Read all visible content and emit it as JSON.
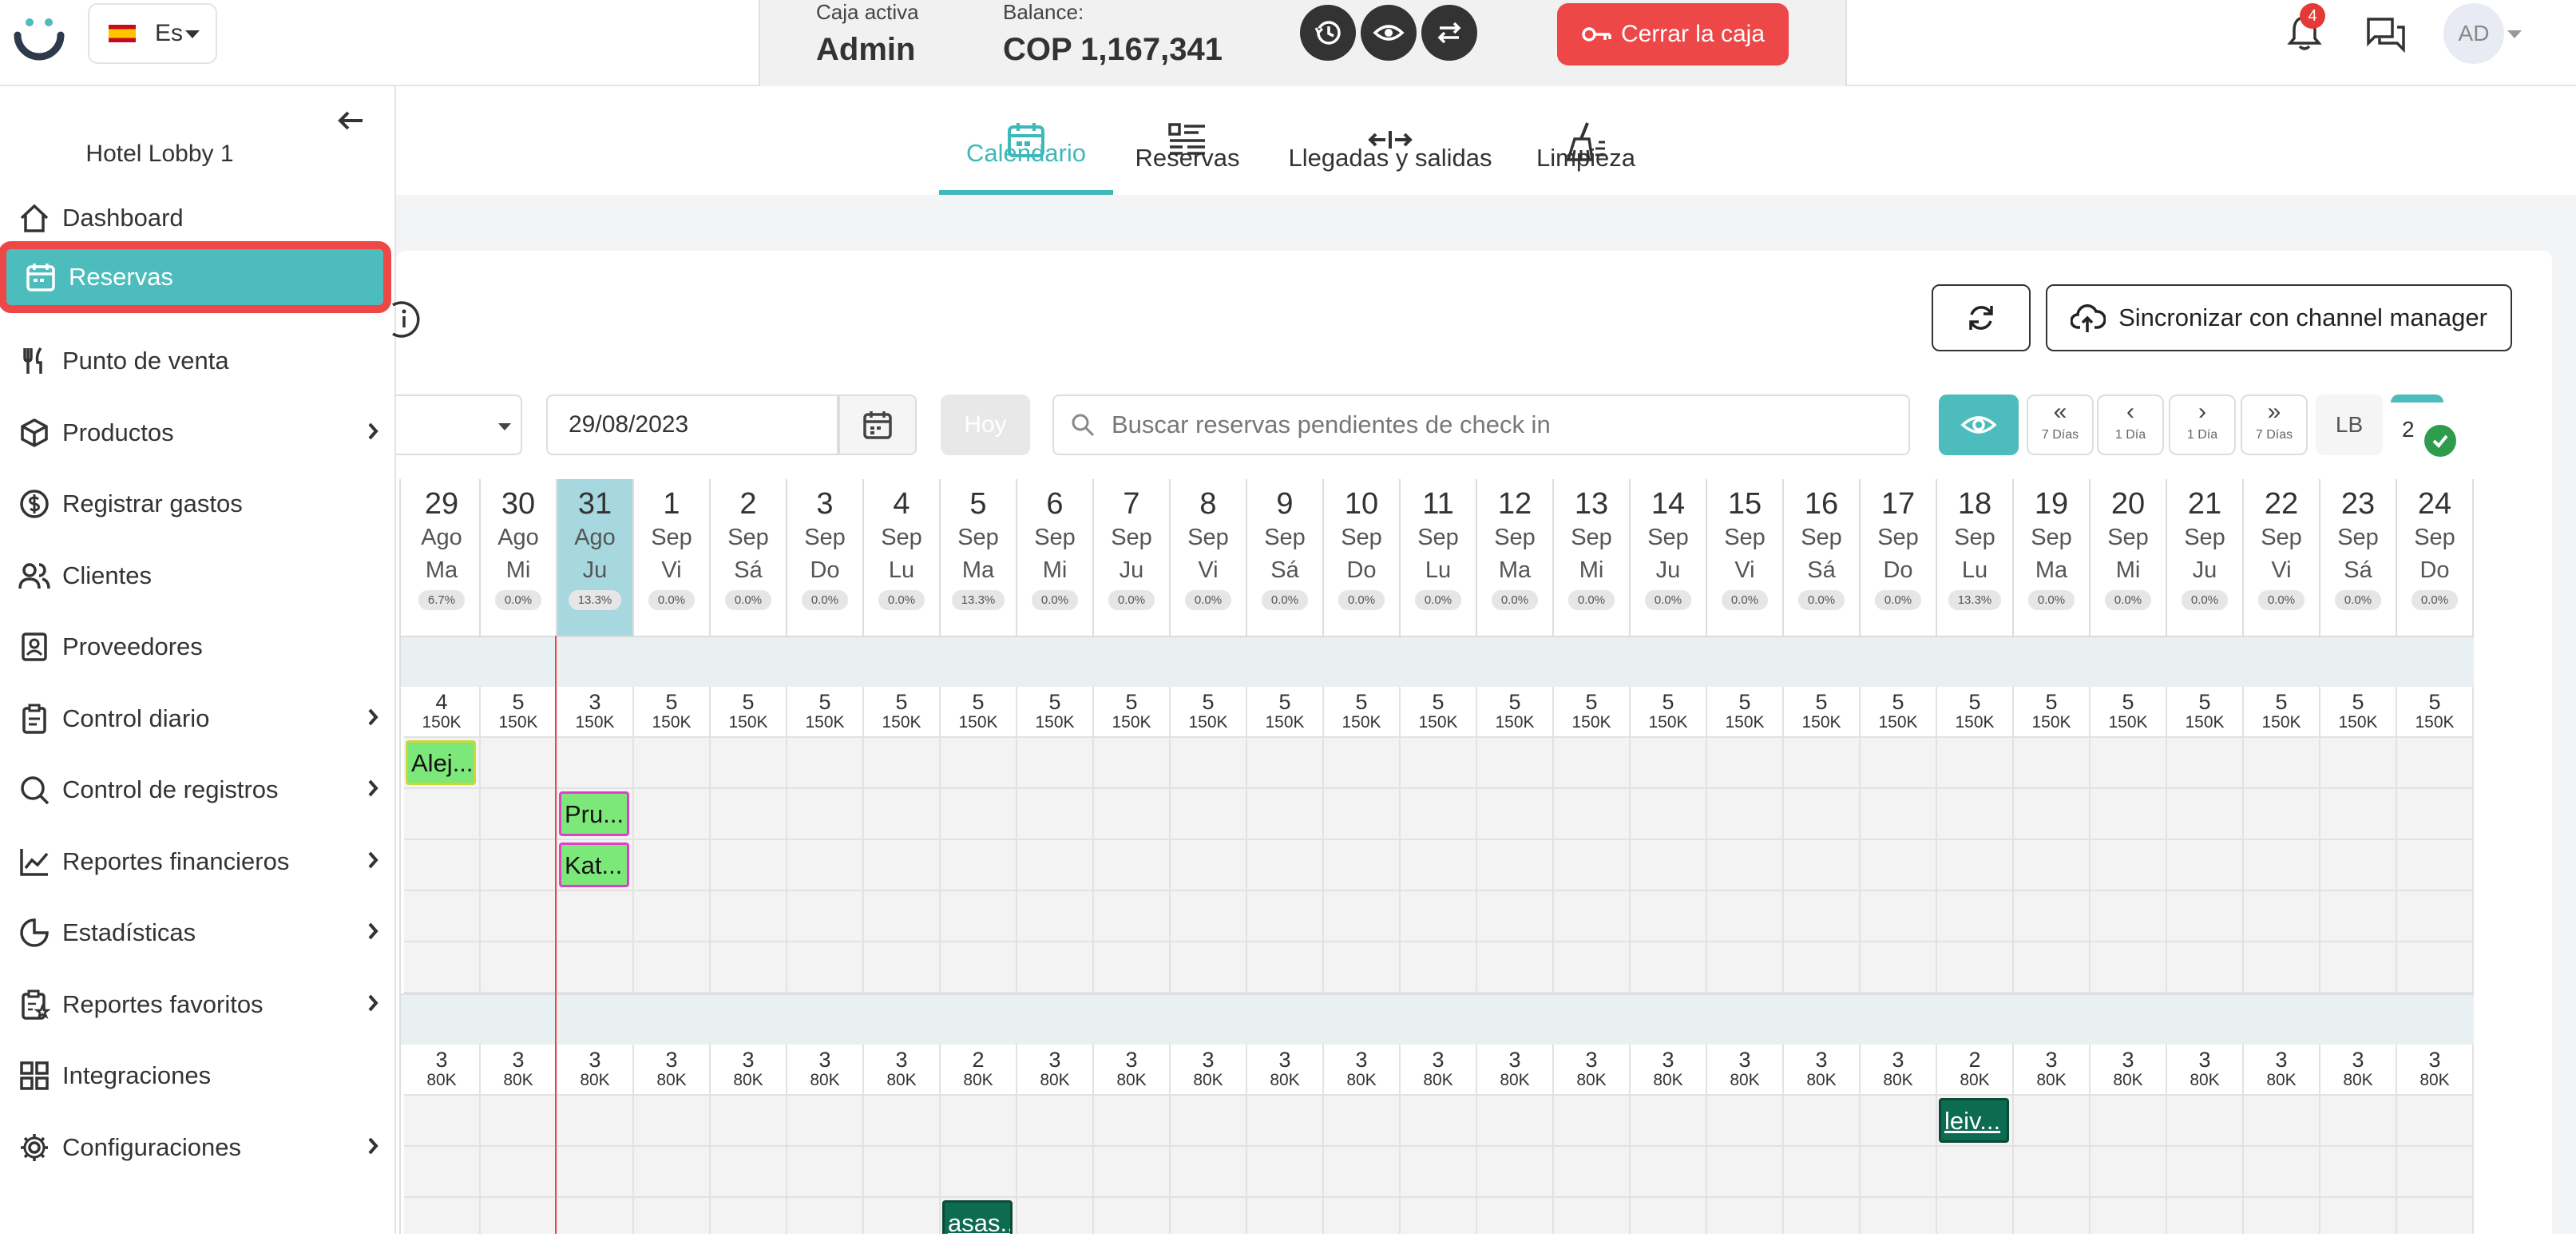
{
  "header": {
    "language": "Es",
    "cash_label": "Caja activa",
    "cash_user": "Admin",
    "balance_label": "Balance:",
    "balance_value": "COP 1,167,341",
    "close_button": "Cerrar la caja",
    "notification_count": "4",
    "avatar": "AD"
  },
  "sidebar": {
    "hotel": "Hotel Lobby 1",
    "items": [
      {
        "label": "Dashboard",
        "icon": "home-icon"
      },
      {
        "label": "Reservas",
        "icon": "calendar-icon"
      },
      {
        "label": "Punto de venta",
        "icon": "fork-knife-icon"
      },
      {
        "label": "Productos",
        "icon": "box-icon"
      },
      {
        "label": "Registrar gastos",
        "icon": "dollar-icon"
      },
      {
        "label": "Clientes",
        "icon": "users-icon"
      },
      {
        "label": "Proveedores",
        "icon": "contact-icon"
      },
      {
        "label": "Control diario",
        "icon": "clipboard-icon"
      },
      {
        "label": "Control de registros",
        "icon": "search-icon"
      },
      {
        "label": "Reportes financieros",
        "icon": "line-chart-icon"
      },
      {
        "label": "Estadísticas",
        "icon": "pie-chart-icon"
      },
      {
        "label": "Reportes favoritos",
        "icon": "clipboard-star-icon"
      },
      {
        "label": "Integraciones",
        "icon": "grid-icon"
      },
      {
        "label": "Configuraciones",
        "icon": "gear-icon"
      }
    ]
  },
  "tabs": [
    {
      "label": "Calendario",
      "icon": "calendar-icon"
    },
    {
      "label": "Reservas",
      "icon": "list-icon"
    },
    {
      "label": "Llegadas y salidas",
      "icon": "arrows-icon"
    },
    {
      "label": "Limpieza",
      "icon": "broom-icon"
    }
  ],
  "toolbar": {
    "sync_button": "Sincronizar con channel manager",
    "date": "29/08/2023",
    "today_button": "Hoy",
    "search_placeholder": "Buscar reservas pendientes de check in",
    "nav": [
      {
        "arrow": "«",
        "label": "7 Días"
      },
      {
        "arrow": "‹",
        "label": "1 Día"
      },
      {
        "arrow": "›",
        "label": "1 Día"
      },
      {
        "arrow": "»",
        "label": "7 Días"
      }
    ],
    "lb": "LB",
    "count": "2"
  },
  "calendar": {
    "days": [
      {
        "n": "29",
        "m": "Ago",
        "w": "Ma",
        "p": "6.7%"
      },
      {
        "n": "30",
        "m": "Ago",
        "w": "Mi",
        "p": "0.0%"
      },
      {
        "n": "31",
        "m": "Ago",
        "w": "Ju",
        "p": "13.3%"
      },
      {
        "n": "1",
        "m": "Sep",
        "w": "Vi",
        "p": "0.0%"
      },
      {
        "n": "2",
        "m": "Sep",
        "w": "Sá",
        "p": "0.0%"
      },
      {
        "n": "3",
        "m": "Sep",
        "w": "Do",
        "p": "0.0%"
      },
      {
        "n": "4",
        "m": "Sep",
        "w": "Lu",
        "p": "0.0%"
      },
      {
        "n": "5",
        "m": "Sep",
        "w": "Ma",
        "p": "13.3%"
      },
      {
        "n": "6",
        "m": "Sep",
        "w": "Mi",
        "p": "0.0%"
      },
      {
        "n": "7",
        "m": "Sep",
        "w": "Ju",
        "p": "0.0%"
      },
      {
        "n": "8",
        "m": "Sep",
        "w": "Vi",
        "p": "0.0%"
      },
      {
        "n": "9",
        "m": "Sep",
        "w": "Sá",
        "p": "0.0%"
      },
      {
        "n": "10",
        "m": "Sep",
        "w": "Do",
        "p": "0.0%"
      },
      {
        "n": "11",
        "m": "Sep",
        "w": "Lu",
        "p": "0.0%"
      },
      {
        "n": "12",
        "m": "Sep",
        "w": "Ma",
        "p": "0.0%"
      },
      {
        "n": "13",
        "m": "Sep",
        "w": "Mi",
        "p": "0.0%"
      },
      {
        "n": "14",
        "m": "Sep",
        "w": "Ju",
        "p": "0.0%"
      },
      {
        "n": "15",
        "m": "Sep",
        "w": "Vi",
        "p": "0.0%"
      },
      {
        "n": "16",
        "m": "Sep",
        "w": "Sá",
        "p": "0.0%"
      },
      {
        "n": "17",
        "m": "Sep",
        "w": "Do",
        "p": "0.0%"
      },
      {
        "n": "18",
        "m": "Sep",
        "w": "Lu",
        "p": "13.3%"
      },
      {
        "n": "19",
        "m": "Sep",
        "w": "Ma",
        "p": "0.0%"
      },
      {
        "n": "20",
        "m": "Sep",
        "w": "Mi",
        "p": "0.0%"
      },
      {
        "n": "21",
        "m": "Sep",
        "w": "Ju",
        "p": "0.0%"
      },
      {
        "n": "22",
        "m": "Sep",
        "w": "Vi",
        "p": "0.0%"
      },
      {
        "n": "23",
        "m": "Sep",
        "w": "Sá",
        "p": "0.0%"
      },
      {
        "n": "24",
        "m": "Sep",
        "w": "Do",
        "p": "0.0%"
      }
    ],
    "today_index": 2,
    "groups": [
      {
        "availability": [
          "4",
          "5",
          "3",
          "5",
          "5",
          "5",
          "5",
          "5",
          "5",
          "5",
          "5",
          "5",
          "5",
          "5",
          "5",
          "5",
          "5",
          "5",
          "5",
          "5",
          "5",
          "5",
          "5",
          "5",
          "5",
          "5",
          "5"
        ],
        "price": "150K",
        "room_rows": 5,
        "reservations": [
          {
            "label": "Alej...",
            "row": 0,
            "start": 0,
            "span": 1,
            "style": "light",
            "border": "#c8d83a"
          },
          {
            "label": "Pru...",
            "row": 1,
            "start": 2,
            "span": 1,
            "style": "light",
            "border": "#e040c8"
          },
          {
            "label": "Kat...",
            "row": 2,
            "start": 2,
            "span": 1,
            "style": "light",
            "border": "#e040c8"
          }
        ]
      },
      {
        "availability": [
          "3",
          "3",
          "3",
          "3",
          "3",
          "3",
          "3",
          "2",
          "3",
          "3",
          "3",
          "3",
          "3",
          "3",
          "3",
          "3",
          "3",
          "3",
          "3",
          "3",
          "2",
          "3",
          "3",
          "3",
          "3",
          "3",
          "3"
        ],
        "price": "80K",
        "room_rows": 3,
        "reservations": [
          {
            "label": "leiv...",
            "row": 0,
            "start": 20,
            "span": 1,
            "style": "dark",
            "border": "#0a4a38"
          },
          {
            "label": "asas...",
            "row": 2,
            "start": 7,
            "span": 1,
            "style": "dark",
            "border": "#0a4a38"
          }
        ]
      }
    ]
  }
}
